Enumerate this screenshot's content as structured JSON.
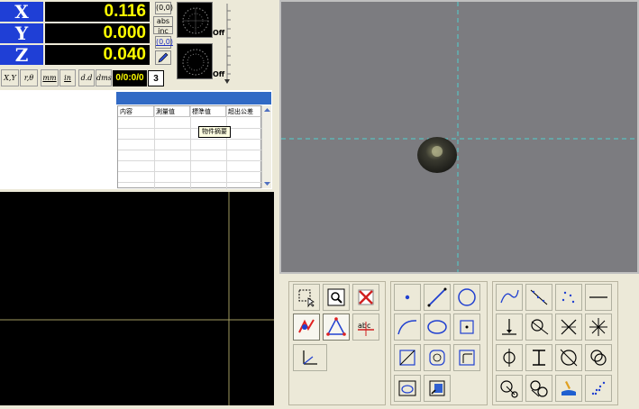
{
  "dro": {
    "x_label": "X",
    "x_value": "0.116",
    "y_label": "Y",
    "y_value": "0.000",
    "z_label": "Z",
    "z_value": "0.040"
  },
  "mode_buttons": {
    "origin": "(0,0)",
    "abs": "abs",
    "inc": "inc",
    "origin2": "(0,0)"
  },
  "lamps": {
    "top_state": "Off",
    "bottom_state": "Off"
  },
  "units": {
    "xy": "X,Y",
    "rtheta": "r,θ",
    "mm": "mm",
    "in": "in",
    "dd": "d.d",
    "dms": "dms"
  },
  "counter": {
    "value": "0/0:0/0",
    "index": "3"
  },
  "table": {
    "columns": [
      "内容",
      "測量值",
      "標準值",
      "超出公差"
    ],
    "tooltip": "物件摘要"
  },
  "colors": {
    "dro_label_bg": "#1f3fd6",
    "dro_value_fg": "#ffff00",
    "crosshair": "#4fd0d0",
    "selection_bar": "#316ac5"
  },
  "toolbar_icons": [
    "select-area-icon",
    "zoom-window-icon",
    "delete-feature-icon",
    "auto-measure-icon",
    "edge-detect-icon",
    "text-label-icon",
    "coordinate-system-icon",
    "point-icon",
    "line-icon",
    "circle-icon",
    "arc-icon",
    "ellipse-icon",
    "center-point-icon",
    "rectangle-icon",
    "slot-icon",
    "rounded-rect-icon",
    "probe-icon",
    "export-icon",
    "curve-icon",
    "line-fit-icon",
    "point-cloud-icon",
    "horizontal-line-icon",
    "perpendicular-icon",
    "tangent-icon",
    "intersection-icon",
    "star-icon",
    "circle-line-icon",
    "i-beam-icon",
    "circle-diagonal-icon",
    "two-circles-icon",
    "circle-distance-icon",
    "circle-pair-icon",
    "paint-icon",
    "point-scatter-icon"
  ]
}
